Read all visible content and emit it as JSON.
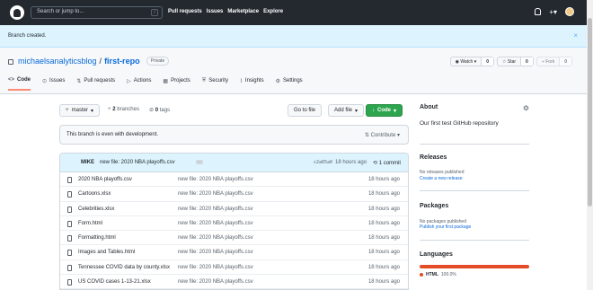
{
  "topnav": {
    "search_placeholder": "Search or jump to...",
    "search_key": "/",
    "links": [
      "Pull requests",
      "Issues",
      "Marketplace",
      "Explore"
    ],
    "plus_label": "+▾"
  },
  "flash": {
    "message": "Branch created.",
    "close": "×"
  },
  "repo": {
    "owner": "michaelsanalyticsblog",
    "separator": "/",
    "name": "first-repo",
    "visibility": "Private",
    "watch_label": "◉ Watch ▾",
    "watch_count": "0",
    "star_label": "☆ Star",
    "star_count": "0",
    "fork_label": "⑂ Fork",
    "fork_count": "0"
  },
  "tabs": [
    {
      "icon": "<>",
      "label": "Code"
    },
    {
      "icon": "⊙",
      "label": "Issues"
    },
    {
      "icon": "⇅",
      "label": "Pull requests"
    },
    {
      "icon": "▷",
      "label": "Actions"
    },
    {
      "icon": "▦",
      "label": "Projects"
    },
    {
      "icon": "⛨",
      "label": "Security"
    },
    {
      "icon": "⌇",
      "label": "Insights"
    },
    {
      "icon": "⚙",
      "label": "Settings"
    }
  ],
  "toolbar": {
    "branch": "master",
    "branches_count": "2",
    "branches_label": "branches",
    "tags_count": "0",
    "tags_label": "tags",
    "goto_file": "Go to file",
    "add_file": "Add file",
    "code": "Code"
  },
  "even_bar": {
    "text": "This branch is even with development.",
    "contribute": "Contribute"
  },
  "commit": {
    "author": "MIKE",
    "message": "new file: 2020 NBA playoffs.csv",
    "dots": "...",
    "sha": "c2a65a0",
    "time": "18 hours ago",
    "count_label": "1 commit"
  },
  "files": [
    {
      "name": "2020 NBA playoffs.csv",
      "message": "new file: 2020 NBA playoffs.csv",
      "time": "18 hours ago"
    },
    {
      "name": "Cartoons.xlsx",
      "message": "new file: 2020 NBA playoffs.csv",
      "time": "18 hours ago"
    },
    {
      "name": "Celebrities.xlsx",
      "message": "new file: 2020 NBA playoffs.csv",
      "time": "18 hours ago"
    },
    {
      "name": "Form.html",
      "message": "new file: 2020 NBA playoffs.csv",
      "time": "18 hours ago"
    },
    {
      "name": "Formatting.html",
      "message": "new file: 2020 NBA playoffs.csv",
      "time": "18 hours ago"
    },
    {
      "name": "Images and Tables.html",
      "message": "new file: 2020 NBA playoffs.csv",
      "time": "18 hours ago"
    },
    {
      "name": "Tennessee COVID data by county.xlsx",
      "message": "new file: 2020 NBA playoffs.csv",
      "time": "18 hours ago"
    },
    {
      "name": "US COVID cases 1-13-21.xlsx",
      "message": "new file: 2020 NBA playoffs.csv",
      "time": "18 hours ago"
    }
  ],
  "sidebar": {
    "about_title": "About",
    "about_text": "Our first test GitHub repository",
    "releases_title": "Releases",
    "releases_none": "No releases published",
    "releases_link": "Create a new release",
    "packages_title": "Packages",
    "packages_none": "No packages published",
    "packages_link": "Publish your first package",
    "languages_title": "Languages",
    "language": "HTML",
    "language_pct": "100.0%",
    "language_color": "#e34c26"
  }
}
